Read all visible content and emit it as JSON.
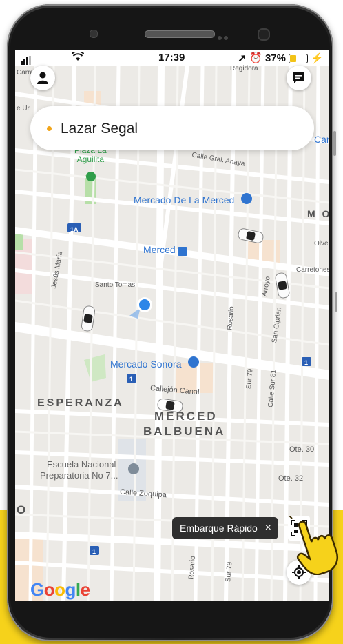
{
  "status_bar": {
    "time": "17:39",
    "battery": "37%"
  },
  "search": {
    "destination": "Lazar Segal"
  },
  "map_labels": {
    "plaza": "Plaza La Aguilita",
    "plaza_line1": "Plaza La",
    "plaza_line2": "Aguilita",
    "market_merced": "Mercado De La Merced",
    "metro_merced": "Merced",
    "market_sonora": "Mercado Sonora",
    "area_esperanza": "ESPERANZA",
    "area_merced_line1": "MERCED",
    "area_merced_line2": "BALBUENA",
    "area_mo": "M O",
    "school_line1": "Escuela Nacional",
    "school_line2": "Preparatoria No 7...",
    "st_gral_anaya": "Calle Gral. Anaya",
    "st_santo_tomas": "Santo Tomas",
    "st_jesus_maria": "Jesús María",
    "st_rosario": "Rosario",
    "st_arroyo": "Arroyo",
    "st_san_ciprian": "San Ciprián",
    "st_carretones": "Carretones",
    "st_olvera": "Olve",
    "st_callejon_canal": "Callejón Canal",
    "st_calle_zoquipa": "Calle Zoquipa",
    "st_sur79": "Sur 79",
    "st_calle_sur81": "Calle Sur 81",
    "st_ote30": "Ote. 30",
    "st_ote32": "Ote. 32",
    "st_carr": "Carra",
    "st_de_ur": "e Ur",
    "st_can": "Can",
    "st_regidora": "Regidora",
    "st_rosario2": "Rosario",
    "st_sur79b": "Sur 79",
    "road_1a": "1A",
    "road_1": "1",
    "edge_o": "O"
  },
  "quick_board": {
    "label": "Embarque Rápido",
    "close": "×"
  },
  "map_attribution": [
    "G",
    "o",
    "o",
    "g",
    "l",
    "e"
  ],
  "colors": {
    "accent_yellow": "#f6d21b",
    "user_location": "#2d86e8",
    "metro_blue": "#2f74d0",
    "dot_orange": "#f2a51a"
  },
  "icons": {
    "profile": "person-icon",
    "messages": "chat-icon",
    "qr": "qr-code-icon",
    "locate": "my-location-icon"
  }
}
